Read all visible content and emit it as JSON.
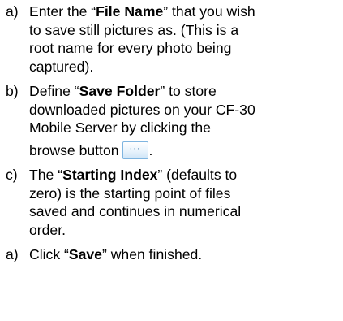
{
  "items": [
    {
      "marker": "a)",
      "lines": [
        {
          "pre": "Enter the “",
          "bold": "File Name",
          "post": "” that you wish"
        },
        {
          "text": "to save still pictures as. (This is a"
        },
        {
          "text": "root name for every photo being"
        },
        {
          "text": "captured)."
        }
      ]
    },
    {
      "marker": "b)",
      "lines": [
        {
          "pre": "Define “",
          "bold": "Save Folder",
          "post": "” to store"
        },
        {
          "text": "downloaded pictures on your CF-30"
        },
        {
          "text": "Mobile Server by clicking the"
        },
        {
          "text": "browse button",
          "after": "."
        }
      ],
      "button": {
        "label": "···",
        "icon": "browse-button-icon"
      }
    },
    {
      "marker": "c)",
      "lines": [
        {
          "pre": "The “",
          "bold": "Starting Index",
          "post": "” (defaults to"
        },
        {
          "text": "zero) is the starting point of files"
        },
        {
          "text": "saved and continues in numerical"
        },
        {
          "text": "order."
        }
      ]
    },
    {
      "marker": "a)",
      "lines": [
        {
          "pre": "Click “",
          "bold": "Save",
          "post": "” when finished."
        }
      ]
    }
  ]
}
